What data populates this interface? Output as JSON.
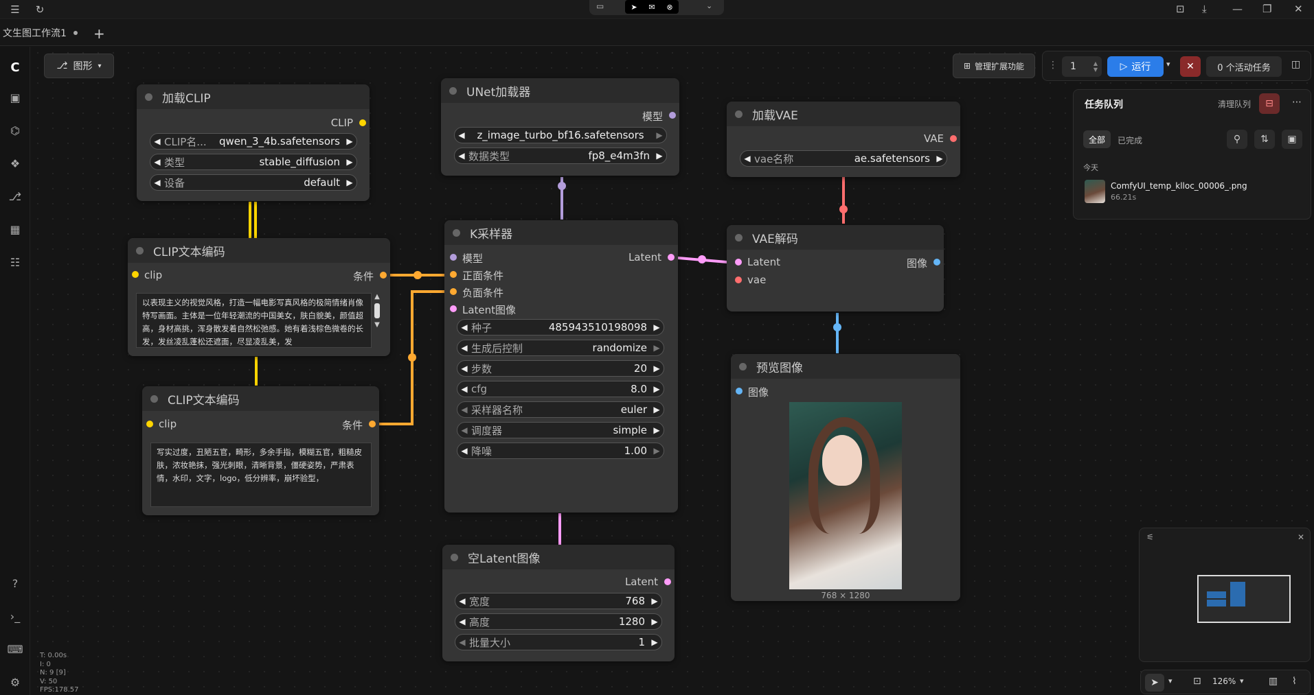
{
  "window": {
    "tabs": [
      "文生图工作流1"
    ]
  },
  "toolbar": {
    "mode_label": "图形",
    "manage_ext_label": "管理扩展功能",
    "batch_count": "1",
    "run_label": "运行",
    "active_tasks_label": "0 个活动任务"
  },
  "queue": {
    "title": "任务队列",
    "clear_label": "清理队列",
    "filter_all": "全部",
    "filter_done": "已完成",
    "group_label": "今天",
    "item_name": "ComfyUI_temp_klloc_00006_.png",
    "item_time": "66.21s"
  },
  "nodes": {
    "load_clip": {
      "title": "加载CLIP",
      "output": "CLIP",
      "widgets": [
        {
          "label": "CLIP名...",
          "value": "qwen_3_4b.safetensors"
        },
        {
          "label": "类型",
          "value": "stable_diffusion"
        },
        {
          "label": "设备",
          "value": "default"
        }
      ]
    },
    "unet": {
      "title": "UNet加载器",
      "output": "模型",
      "widgets": [
        {
          "label": "",
          "value": "z_image_turbo_bf16.safetensors"
        },
        {
          "label": "数据类型",
          "value": "fp8_e4m3fn"
        }
      ]
    },
    "load_vae": {
      "title": "加载VAE",
      "output": "VAE",
      "widgets": [
        {
          "label": "vae名称",
          "value": "ae.safetensors"
        }
      ]
    },
    "clip_pos": {
      "title": "CLIP文本编码",
      "input": "clip",
      "output": "条件",
      "text": "以表现主义的视觉风格，打造一幅电影写真风格的极简情绪肖像特写画面。主体是一位年轻潮流的中国美女，肤白貌美，颜值超高，身材高挑，浑身散发着自然松弛感。她有着浅棕色微卷的长发，发丝凌乱蓬松还遮面，尽显凌乱美，发"
    },
    "clip_neg": {
      "title": "CLIP文本编码",
      "input": "clip",
      "output": "条件",
      "text": "写实过度，丑陋五官，畸形，多余手指，模糊五官，粗糙皮肤，浓妆艳抹，强光刺眼，清晰背景，僵硬姿势，严肃表情，水印，文字，logo，低分辨率，崩坏验型，"
    },
    "ksampler": {
      "title": "K采样器",
      "inputs": [
        "模型",
        "正面条件",
        "负面条件",
        "Latent图像"
      ],
      "output": "Latent",
      "widgets": [
        {
          "label": "种子",
          "value": "485943510198098"
        },
        {
          "label": "生成后控制",
          "value": "randomize"
        },
        {
          "label": "步数",
          "value": "20"
        },
        {
          "label": "cfg",
          "value": "8.0"
        },
        {
          "label": "采样器名称",
          "value": "euler"
        },
        {
          "label": "调度器",
          "value": "simple"
        },
        {
          "label": "降噪",
          "value": "1.00"
        }
      ]
    },
    "vae_decode": {
      "title": "VAE解码",
      "inputs": [
        "Latent",
        "vae"
      ],
      "output": "图像"
    },
    "preview": {
      "title": "预览图像",
      "input": "图像",
      "size_label": "768 × 1280"
    },
    "empty_latent": {
      "title": "空Latent图像",
      "output": "Latent",
      "widgets": [
        {
          "label": "宽度",
          "value": "768"
        },
        {
          "label": "高度",
          "value": "1280"
        },
        {
          "label": "批量大小",
          "value": "1"
        }
      ]
    }
  },
  "stats": {
    "t": "T: 0.00s",
    "i": "I: 0",
    "n": "N: 9 [9]",
    "v": "V: 50",
    "fps": "FPS:178.57"
  },
  "zoom": "126%",
  "colors": {
    "clip": "#ffd500",
    "cond": "#ffa931",
    "model": "#b39ddb",
    "latent": "#ff9cf9",
    "vae": "#ff6e6e",
    "image": "#64b5f6",
    "run": "#2b7de9"
  }
}
